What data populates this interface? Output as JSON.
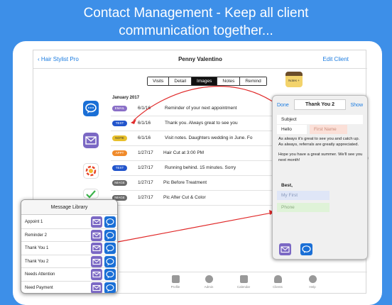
{
  "headline": {
    "line1": "Contact Management - Keep all client",
    "line2": "communication together..."
  },
  "navbar": {
    "back": "Hair Stylist Pro",
    "title": "Penny Valentino",
    "edit": "Edit Client"
  },
  "segments": [
    "Visits",
    "Detail",
    "Images",
    "Notes",
    "Remind"
  ],
  "active_segment": "Images",
  "notes_icon_label": "Notes +",
  "month": "January 2017",
  "rows": [
    {
      "badge": "EMAIL",
      "color": "#8a6fc7",
      "date": "6/1/16",
      "desc": "Reminder of your next appointment"
    },
    {
      "badge": "TEXT",
      "color": "#2255cc",
      "date": "6/1/16",
      "desc": "Thank you.  Always great to see you"
    },
    {
      "badge": "NOTE",
      "color": "#e8c02c",
      "date": "6/1/16",
      "desc": "Visit notes.  Daughters wedding in June. Fo"
    },
    {
      "badge": "APPT",
      "color": "#f08a2a",
      "date": "1/27/17",
      "desc": "Hair Cut at 3:00 PM"
    },
    {
      "badge": "TEXT",
      "color": "#2255cc",
      "date": "1/27/17",
      "desc": "Running behind. 15 minutes. Sorry"
    },
    {
      "badge": "IMAGE",
      "color": "#6a6a6a",
      "date": "1/27/17",
      "desc": "Pic Before Treatment"
    },
    {
      "badge": "IMAGE",
      "color": "#6a6a6a",
      "date": "1/27/17",
      "desc": "Pic After Cut & Color"
    }
  ],
  "tabs": [
    "Profile",
    "Admin",
    "Calendar",
    "Clients",
    "Help"
  ],
  "popover": {
    "done": "Done",
    "title": "Thank You 2",
    "show": "Show",
    "subject_placeholder": "Subject",
    "greeting": "Hello",
    "first_name_token": "First Name",
    "body1": "As always it's great to see you and catch up.  As always, referrals are greatly appreciated.",
    "body2": "Hope you have a great summer.  We'll see you next month!",
    "closing": "Best,",
    "my_first_token": "My First",
    "phone_token": "Phone"
  },
  "library": {
    "title": "Message Library",
    "items": [
      "Appoint 1",
      "Reminder 2",
      "Thank You 1",
      "Thank You 2",
      "Needs Attention",
      "Need Payment"
    ]
  },
  "colors": {
    "background": "#3d8fe8",
    "accent": "#1a7be0",
    "mail_button": "#7b68c4",
    "chat_button": "#1a6fd6",
    "arrow": "#e02828"
  }
}
